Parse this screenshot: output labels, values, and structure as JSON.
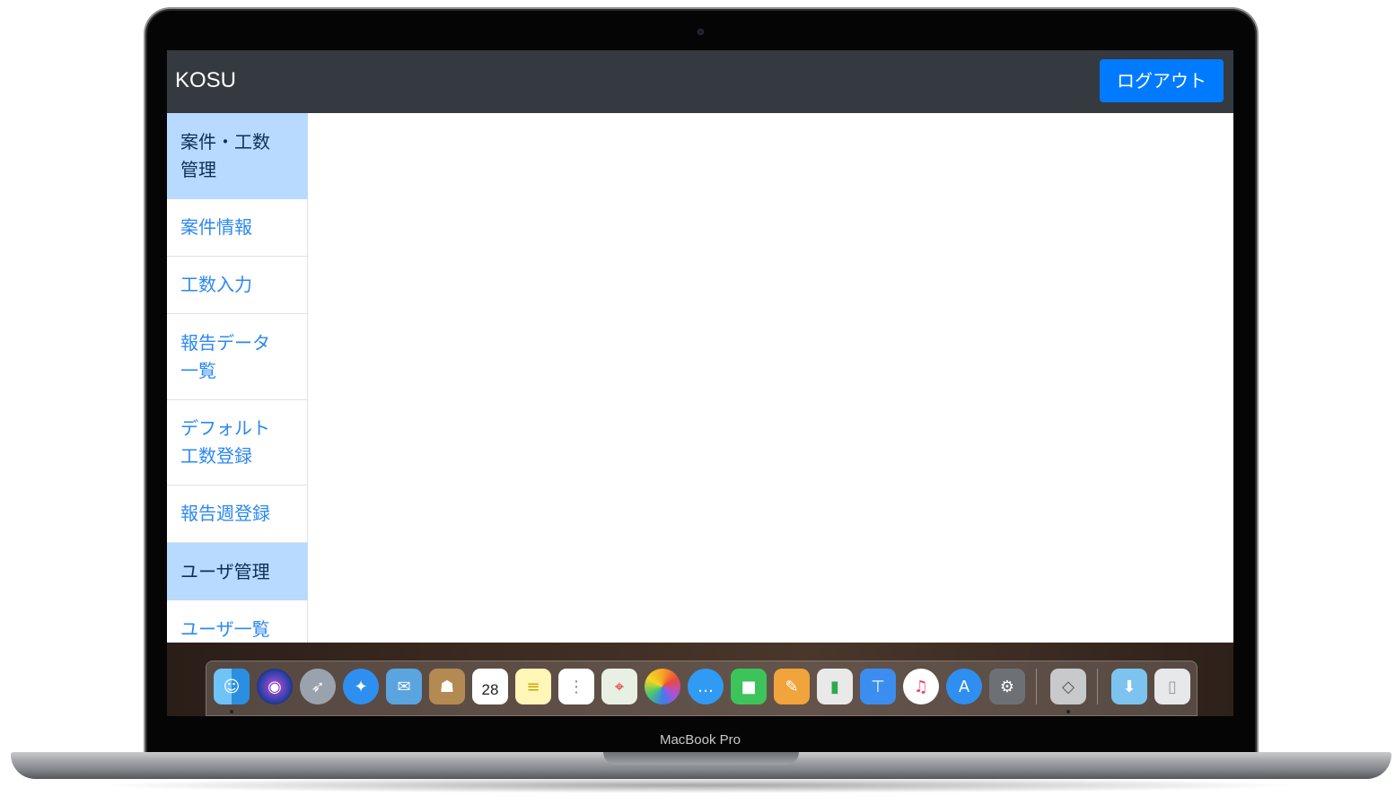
{
  "app": {
    "brand": "KOSU",
    "logout_label": "ログアウト"
  },
  "sidebar": {
    "items": [
      {
        "label": "案件・工数\n管理",
        "type": "header"
      },
      {
        "label": "案件情報",
        "type": "link"
      },
      {
        "label": "工数入力",
        "type": "link"
      },
      {
        "label": "報告データ\n一覧",
        "type": "link"
      },
      {
        "label": "デフォルト\n工数登録",
        "type": "link"
      },
      {
        "label": "報告週登録",
        "type": "link"
      },
      {
        "label": "ユーザ管理",
        "type": "header"
      },
      {
        "label": "ユーザ一覧",
        "type": "link"
      }
    ]
  },
  "dock": {
    "calendar_day": "28",
    "apps": [
      "finder-icon",
      "siri-icon",
      "launchpad-icon",
      "safari-icon",
      "mail-icon",
      "contacts-icon",
      "calendar-icon",
      "notes-icon",
      "reminders-icon",
      "maps-icon",
      "photos-icon",
      "messages-icon",
      "facetime-icon",
      "pages-icon",
      "numbers-icon",
      "keynote-icon",
      "itunes-icon",
      "app-store-icon",
      "system-preferences-icon",
      "boot-camp-icon",
      "downloads-folder-icon",
      "trash-icon"
    ]
  },
  "device": {
    "model_label": "MacBook Pro"
  },
  "colors": {
    "navbar": "#343a40",
    "primary": "#007bff",
    "sidebar_header": "#b8daff",
    "link": "#2b88f3"
  }
}
